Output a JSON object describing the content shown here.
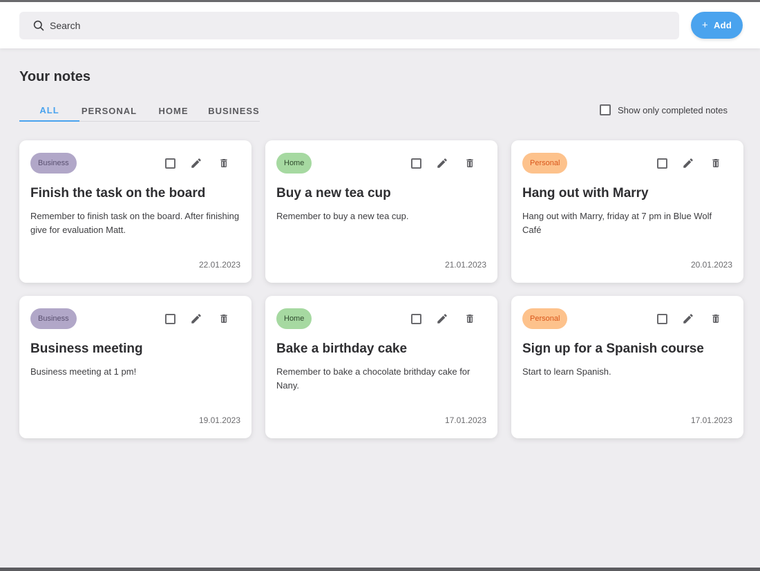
{
  "search": {
    "placeholder": "Search"
  },
  "add_button": {
    "label": "Add"
  },
  "page_title": "Your notes",
  "tabs": [
    {
      "label": "ALL",
      "active": true
    },
    {
      "label": "PERSONAL",
      "active": false
    },
    {
      "label": "HOME",
      "active": false
    },
    {
      "label": "BUSINESS",
      "active": false
    }
  ],
  "filter": {
    "label": "Show only completed notes",
    "checked": false
  },
  "colors": {
    "accent": "#4aa3ee",
    "business_badge": "#b1a7c8",
    "home_badge": "#a6d9a1",
    "personal_badge": "#fdc28c"
  },
  "icons": [
    "search-icon",
    "plus-icon",
    "checkbox-icon",
    "pencil-icon",
    "trash-icon"
  ],
  "notes": [
    {
      "category": "Business",
      "title": "Finish the task on the board",
      "body": "Remember to finish task on the board. After finishing give for evaluation Matt.",
      "date": "22.01.2023"
    },
    {
      "category": "Home",
      "title": "Buy a new tea cup",
      "body": "Remember to buy a new tea cup.",
      "date": "21.01.2023"
    },
    {
      "category": "Personal",
      "title": "Hang out with Marry",
      "body": "Hang out with Marry, friday at 7 pm in Blue Wolf Café",
      "date": "20.01.2023"
    },
    {
      "category": "Business",
      "title": "Business meeting",
      "body": "Business meeting at 1 pm!",
      "date": "19.01.2023"
    },
    {
      "category": "Home",
      "title": "Bake a birthday cake",
      "body": "Remember to bake a chocolate brithday cake for Nany.",
      "date": "17.01.2023"
    },
    {
      "category": "Personal",
      "title": "Sign up for a Spanish course",
      "body": "Start to learn Spanish.",
      "date": "17.01.2023"
    }
  ]
}
